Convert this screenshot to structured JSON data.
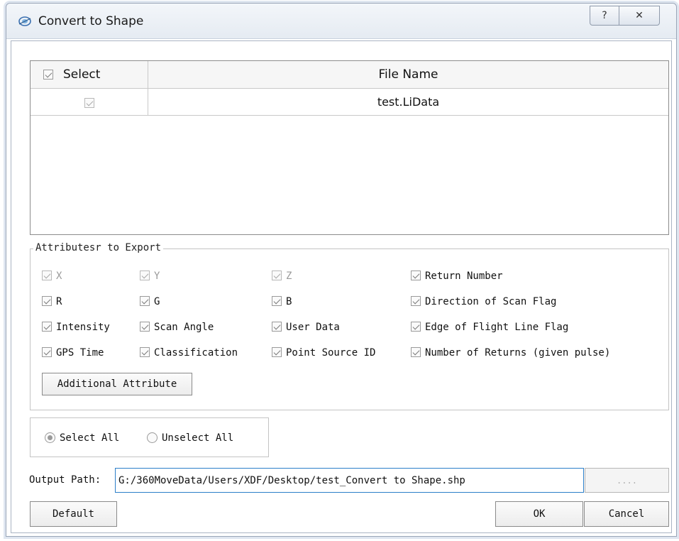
{
  "window": {
    "title": "Convert to Shape",
    "help_glyph": "?",
    "close_glyph": "✕"
  },
  "file_table": {
    "headers": {
      "select": "Select",
      "file_name": "File Name"
    },
    "rows": [
      {
        "checked": true,
        "file_name": "test.LiData"
      }
    ]
  },
  "attributes": {
    "legend": "Attributesr to Export",
    "items": [
      {
        "label": "X",
        "checked": true,
        "enabled": false
      },
      {
        "label": "Y",
        "checked": true,
        "enabled": false
      },
      {
        "label": "Z",
        "checked": true,
        "enabled": false
      },
      {
        "label": "Return Number",
        "checked": true,
        "enabled": true
      },
      {
        "label": "R",
        "checked": true,
        "enabled": true
      },
      {
        "label": "G",
        "checked": true,
        "enabled": true
      },
      {
        "label": "B",
        "checked": true,
        "enabled": true
      },
      {
        "label": "Direction of Scan Flag",
        "checked": true,
        "enabled": true
      },
      {
        "label": "Intensity",
        "checked": true,
        "enabled": true
      },
      {
        "label": "Scan Angle",
        "checked": true,
        "enabled": true
      },
      {
        "label": "User Data",
        "checked": true,
        "enabled": true
      },
      {
        "label": "Edge of Flight Line Flag",
        "checked": true,
        "enabled": true
      },
      {
        "label": "GPS Time",
        "checked": true,
        "enabled": true
      },
      {
        "label": "Classification",
        "checked": true,
        "enabled": true
      },
      {
        "label": "Point Source ID",
        "checked": true,
        "enabled": true
      },
      {
        "label": "Number of Returns (given pulse)",
        "checked": true,
        "enabled": true
      }
    ],
    "additional_button": "Additional Attribute"
  },
  "selection": {
    "select_all": "Select All",
    "unselect_all": "Unselect All",
    "selected": "select_all"
  },
  "output": {
    "label": "Output Path:",
    "value": "G:/360MoveData/Users/XDF/Desktop/test_Convert to Shape.shp",
    "browse_label": "...."
  },
  "buttons": {
    "default": "Default",
    "ok": "OK",
    "cancel": "Cancel"
  }
}
